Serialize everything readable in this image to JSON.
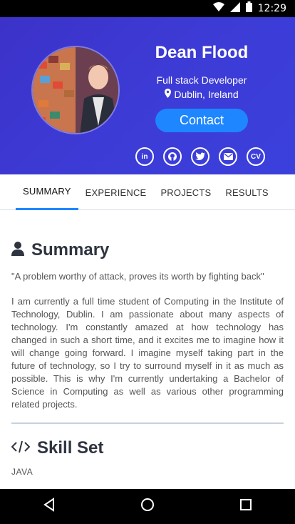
{
  "status_bar": {
    "time": "12:29"
  },
  "profile": {
    "name": "Dean Flood",
    "role": "Full stack Developer",
    "location": "Dublin, Ireland",
    "contact_label": "Contact",
    "socials": [
      {
        "label": "in",
        "icon": "linkedin-icon"
      },
      {
        "label": "",
        "icon": "github-icon"
      },
      {
        "label": "",
        "icon": "twitter-icon"
      },
      {
        "label": "",
        "icon": "email-icon"
      },
      {
        "label": "CV",
        "icon": "cv-icon"
      }
    ]
  },
  "tabs": [
    {
      "label": "SUMMARY",
      "active": true
    },
    {
      "label": "EXPERIENCE",
      "active": false
    },
    {
      "label": "PROJECTS",
      "active": false
    },
    {
      "label": "RESULTS",
      "active": false
    }
  ],
  "summary": {
    "title": "Summary",
    "quote": "\"A problem worthy of attack, proves its worth by fighting back\"",
    "body": "I am currently a full time student of Computing in the Institute of Technology, Dublin. I am passionate about many aspects of technology. I'm constantly amazed at how technology has changed in such a short time, and it excites me to imagine how it will change going forward. I imagine myself taking part in the future of technology, so I try to surround myself in it as much as possible. This is why I'm currently undertaking a Bachelor of Science in Computing as well as various other programming related projects."
  },
  "skills": {
    "title": "Skill Set",
    "items": [
      "JAVA"
    ]
  },
  "colors": {
    "header": "#3d3bd6",
    "accent": "#1e86ff",
    "heading": "#2f3440"
  }
}
